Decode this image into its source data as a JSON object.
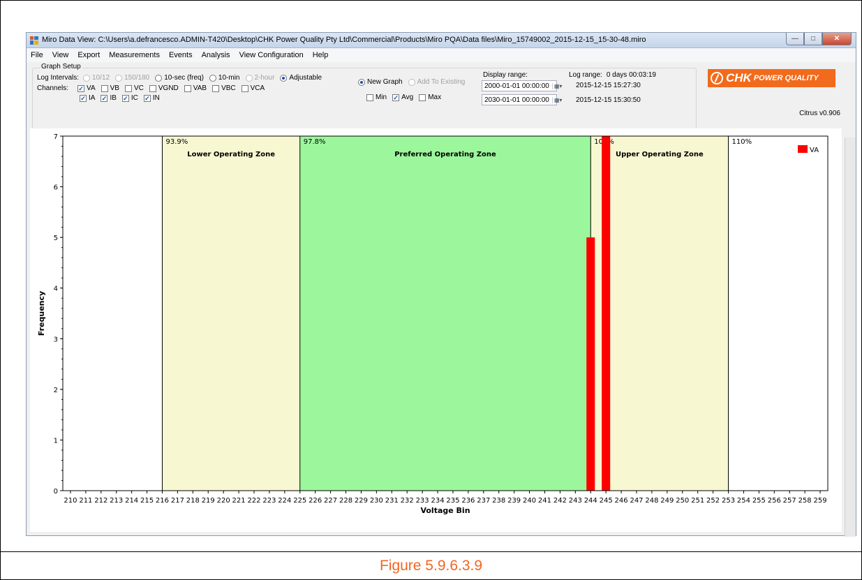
{
  "window": {
    "title": "Miro Data View: C:\\Users\\a.defrancesco.ADMIN-T420\\Desktop\\CHK Power Quality Pty Ltd\\Commercial\\Products\\Miro PQA\\Data files\\Miro_15749002_2015-12-15_15-30-48.miro"
  },
  "menu": [
    "File",
    "View",
    "Export",
    "Measurements",
    "Events",
    "Analysis",
    "View Configuration",
    "Help"
  ],
  "graph_setup": {
    "legend": "Graph Setup",
    "log_intervals_label": "Log Intervals:",
    "intervals": [
      {
        "label": "10/12",
        "selected": false,
        "enabled": false
      },
      {
        "label": "150/180",
        "selected": false,
        "enabled": false
      },
      {
        "label": "10-sec (freq)",
        "selected": false,
        "enabled": true
      },
      {
        "label": "10-min",
        "selected": false,
        "enabled": true
      },
      {
        "label": "2-hour",
        "selected": false,
        "enabled": false
      },
      {
        "label": "Adjustable",
        "selected": true,
        "enabled": true
      }
    ],
    "channels_label": "Channels:",
    "channels_row1": [
      {
        "label": "VA",
        "checked": true
      },
      {
        "label": "VB",
        "checked": false
      },
      {
        "label": "VC",
        "checked": false
      },
      {
        "label": "VGND",
        "checked": false
      },
      {
        "label": "VAB",
        "checked": false
      },
      {
        "label": "VBC",
        "checked": false
      },
      {
        "label": "VCA",
        "checked": false
      }
    ],
    "channels_row2": [
      {
        "label": "IA",
        "checked": true
      },
      {
        "label": "IB",
        "checked": true
      },
      {
        "label": "IC",
        "checked": true
      },
      {
        "label": "IN",
        "checked": true
      }
    ],
    "new_graph": "New Graph",
    "add_to_existing": "Add To Existing",
    "stats": [
      {
        "label": "Min",
        "checked": false
      },
      {
        "label": "Avg",
        "checked": true
      },
      {
        "label": "Max",
        "checked": false
      }
    ],
    "display_range_label": "Display range:",
    "display_from": "2000-01-01 00:00:00",
    "display_to": "2030-01-01 00:00:00",
    "log_range_label": "Log range:",
    "log_range_value": "0 days 00:03:19",
    "log_start": "2015-12-15 15:27:30",
    "log_end": "2015-12-15 15:30:50"
  },
  "logo": {
    "chk": "CHK",
    "pq": "POWER QUALITY"
  },
  "version": "Citrus v0.906",
  "caption": "Figure 5.9.6.3.9",
  "colors": {
    "bar": "#ff0000",
    "zone_yellow": "#f7f7d2",
    "zone_green": "#9cf79c",
    "logo": "#f26a1b",
    "caption": "#f26522"
  },
  "chart_data": {
    "type": "bar",
    "xlabel": "Voltage Bin",
    "ylabel": "Frequency",
    "x_bins": [
      210,
      211,
      212,
      213,
      214,
      215,
      216,
      217,
      218,
      219,
      220,
      221,
      222,
      223,
      224,
      225,
      226,
      227,
      228,
      229,
      230,
      231,
      232,
      233,
      234,
      235,
      236,
      237,
      238,
      239,
      240,
      241,
      242,
      243,
      244,
      245,
      246,
      247,
      248,
      249,
      250,
      251,
      252,
      253,
      254,
      255,
      256,
      257,
      258,
      259
    ],
    "ylim": [
      0,
      7
    ],
    "yticks": [
      0,
      1,
      2,
      3,
      4,
      5,
      6,
      7
    ],
    "series": [
      {
        "name": "VA",
        "points": [
          {
            "x": 244,
            "y": 5
          },
          {
            "x": 245,
            "y": 7
          }
        ]
      }
    ],
    "zones": [
      {
        "label": "Lower Operating Zone",
        "pct": "93.9%",
        "from": 216,
        "to": 225,
        "color": "#f7f7d2"
      },
      {
        "label": "Preferred Operating Zone",
        "pct": "97.8%",
        "from": 225,
        "to": 244,
        "color": "#9cf79c"
      },
      {
        "label": "Upper Operating Zone",
        "pct": "106%",
        "from": 244,
        "to": 253,
        "color": "#f7f7d2"
      },
      {
        "label": "",
        "pct": "110%",
        "from": 253,
        "to": 253,
        "color": "none"
      }
    ],
    "legend": {
      "position": "top-right",
      "entries": [
        "VA"
      ]
    },
    "grid": false
  }
}
